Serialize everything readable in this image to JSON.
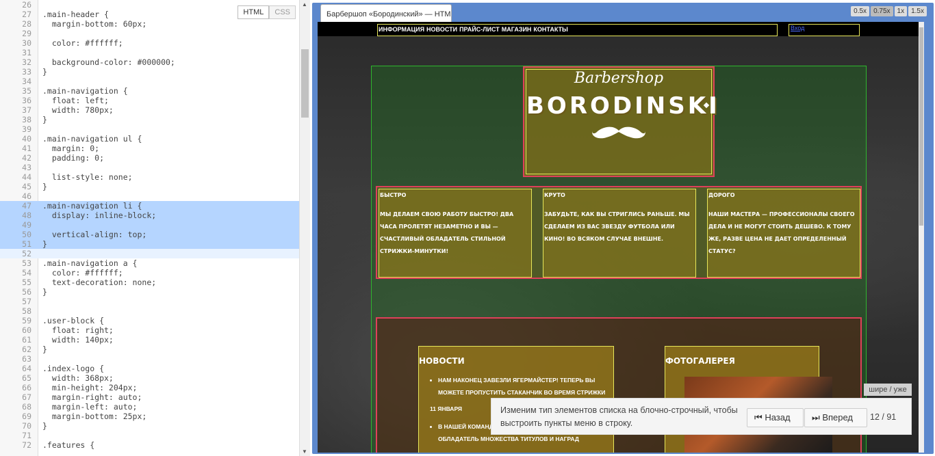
{
  "editor": {
    "tab_html": "HTML",
    "tab_css": "CSS",
    "lines": [
      {
        "n": "26",
        "text": ""
      },
      {
        "n": "27",
        "text": ".main-header {"
      },
      {
        "n": "28",
        "text": "  margin-bottom: 60px;"
      },
      {
        "n": "29",
        "text": ""
      },
      {
        "n": "30",
        "text": "  color: #ffffff;"
      },
      {
        "n": "31",
        "text": ""
      },
      {
        "n": "32",
        "text": "  background-color: #000000;"
      },
      {
        "n": "33",
        "text": "}"
      },
      {
        "n": "34",
        "text": ""
      },
      {
        "n": "35",
        "text": ".main-navigation {"
      },
      {
        "n": "36",
        "text": "  float: left;"
      },
      {
        "n": "37",
        "text": "  width: 780px;"
      },
      {
        "n": "38",
        "text": "}"
      },
      {
        "n": "39",
        "text": ""
      },
      {
        "n": "40",
        "text": ".main-navigation ul {"
      },
      {
        "n": "41",
        "text": "  margin: 0;"
      },
      {
        "n": "42",
        "text": "  padding: 0;"
      },
      {
        "n": "43",
        "text": ""
      },
      {
        "n": "44",
        "text": "  list-style: none;"
      },
      {
        "n": "45",
        "text": "}"
      },
      {
        "n": "46",
        "text": ""
      },
      {
        "n": "47",
        "text": ".main-navigation li {"
      },
      {
        "n": "48",
        "text": "  display: inline-block;"
      },
      {
        "n": "49",
        "text": ""
      },
      {
        "n": "50",
        "text": "  vertical-align: top;"
      },
      {
        "n": "51",
        "text": "}"
      },
      {
        "n": "52",
        "text": ""
      },
      {
        "n": "53",
        "text": ".main-navigation a {"
      },
      {
        "n": "54",
        "text": "  color: #ffffff;"
      },
      {
        "n": "55",
        "text": "  text-decoration: none;"
      },
      {
        "n": "56",
        "text": "}"
      },
      {
        "n": "57",
        "text": ""
      },
      {
        "n": "58",
        "text": ""
      },
      {
        "n": "59",
        "text": ".user-block {"
      },
      {
        "n": "60",
        "text": "  float: right;"
      },
      {
        "n": "61",
        "text": "  width: 140px;"
      },
      {
        "n": "62",
        "text": "}"
      },
      {
        "n": "63",
        "text": ""
      },
      {
        "n": "64",
        "text": ".index-logo {"
      },
      {
        "n": "65",
        "text": "  width: 368px;"
      },
      {
        "n": "66",
        "text": "  min-height: 204px;"
      },
      {
        "n": "67",
        "text": "  margin-right: auto;"
      },
      {
        "n": "68",
        "text": "  margin-left: auto;"
      },
      {
        "n": "69",
        "text": "  margin-bottom: 25px;"
      },
      {
        "n": "70",
        "text": "}"
      },
      {
        "n": "71",
        "text": ""
      },
      {
        "n": "72",
        "text": ".features {"
      }
    ],
    "highlighted_lines": [
      "47",
      "48",
      "49",
      "50",
      "51"
    ],
    "cursor_line": "52"
  },
  "preview": {
    "tab_title": "Барбершоп «Бородинский» — HTML",
    "zoom": [
      "0.5x",
      "0.75x",
      "1x",
      "1.5x"
    ],
    "zoom_active": "0.75x",
    "site": {
      "nav": [
        "ИНФОРМАЦИЯ",
        "НОВОСТИ",
        "ПРАЙС-ЛИСТ",
        "МАГАЗИН",
        "КОНТАКТЫ"
      ],
      "login": "Вход",
      "logo_script": "Barbershop",
      "logo_name": "BORODINSKI",
      "features": [
        {
          "title": "БЫСТРО",
          "text": "МЫ ДЕЛАЕМ СВОЮ РАБОТУ БЫСТРО! ДВА ЧАСА ПРОЛЕТЯТ НЕЗАМЕТНО И ВЫ — СЧАСТЛИВЫЙ ОБЛАДАТЕЛЬ СТИЛЬНОЙ СТРИЖКИ-МИНУТКИ!"
        },
        {
          "title": "КРУТО",
          "text": "ЗАБУДЬТЕ, КАК ВЫ СТРИГЛИСЬ РАНЬШЕ. МЫ СДЕЛАЕМ ИЗ ВАС ЗВЕЗДУ ФУТБОЛА ИЛИ КИНО! ВО ВСЯКОМ СЛУЧАЕ ВНЕШНЕ."
        },
        {
          "title": "ДОРОГО",
          "text": "НАШИ МАСТЕРА — ПРОФЕССИОНАЛЫ СВОЕГО ДЕЛА И НЕ МОГУТ СТОИТЬ ДЕШЕВО. К ТОМУ ЖЕ, РАЗВЕ ЦЕНА НЕ ДАЕТ ОПРЕДЕЛЕННЫЙ СТАТУС?"
        }
      ],
      "news_title": "НОВОСТИ",
      "news": [
        {
          "text": "НАМ НАКОНЕЦ ЗАВЕЗЛИ ЯГЕРМАЙСТЕР! ТЕПЕРЬ ВЫ МОЖЕТЕ ПРОПУСТИТЬ СТАКАНЧИК ВО ВРЕМЯ СТРИЖКИ",
          "date": "11 ЯНВАРЯ"
        },
        {
          "text": "В НАШЕЙ КОМАНДЕ ПОПОЛНЕНИЕ, МАСТЕР СТРИГУНЕЦ, ОБЛАДАТЕЛЬ МНОЖЕСТВА ТИТУЛОВ И НАГРАД",
          "date": ""
        }
      ],
      "gallery_title": "ФОТОГАЛЕРЕЯ"
    },
    "size_button": "шире / уже"
  },
  "tutorial": {
    "text": "Изменим тип элементов списка на блочно-строчный, чтобы выстроить пункты меню в строку.",
    "back": "Назад",
    "forward": "Вперед",
    "progress": "12 / 91"
  }
}
